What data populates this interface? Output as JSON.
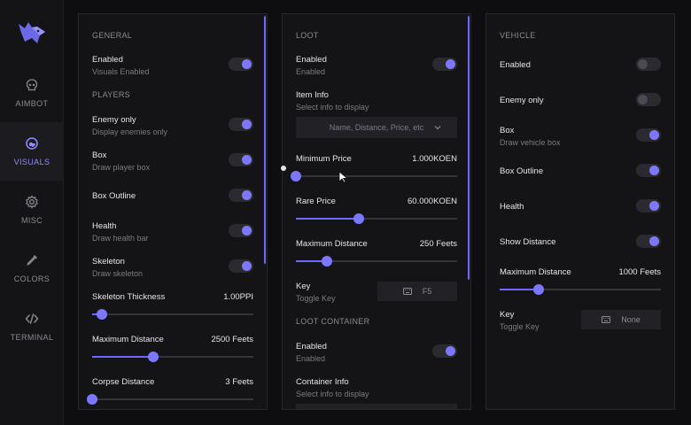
{
  "sidebar": {
    "logo_icon": "wolf-logo-icon",
    "items": [
      {
        "label": "AIMBOT",
        "icon": "skull-icon",
        "active": false
      },
      {
        "label": "VISUALS",
        "icon": "eye-icon",
        "active": true
      },
      {
        "label": "MISC",
        "icon": "gear-icon",
        "active": false
      },
      {
        "label": "COLORS",
        "icon": "eyedropper-icon",
        "active": false
      },
      {
        "label": "TERMINAL",
        "icon": "code-icon",
        "active": false
      }
    ]
  },
  "colors": {
    "accent": "#7b78ff",
    "background": "#0e0e10",
    "panel": "#141416"
  },
  "general": {
    "title": "GENERAL",
    "enabled": {
      "label": "Enabled",
      "desc": "Visuals Enabled",
      "on": true
    }
  },
  "players": {
    "title": "PLAYERS",
    "enemy_only": {
      "label": "Enemy only",
      "desc": "Display enemies only",
      "on": true
    },
    "box": {
      "label": "Box",
      "desc": "Draw player box",
      "on": true
    },
    "box_outline": {
      "label": "Box Outline",
      "on": true
    },
    "health": {
      "label": "Health",
      "desc": "Draw health bar",
      "on": true
    },
    "skeleton": {
      "label": "Skeleton",
      "desc": "Draw skeleton",
      "on": true
    },
    "skeleton_thickness": {
      "label": "Skeleton Thickness",
      "value": "1.00PPI",
      "fraction": 0.06
    },
    "max_distance": {
      "label": "Maximum Distance",
      "value": "2500 Feets",
      "fraction": 0.38
    },
    "corpse_distance": {
      "label": "Corpse Distance",
      "value": "3 Feets",
      "fraction": 0.0
    }
  },
  "loot": {
    "title": "LOOT",
    "enabled": {
      "label": "Enabled",
      "desc": "Enabled",
      "on": true
    },
    "item_info": {
      "label": "Item Info",
      "desc": "Select info to display",
      "dropdown": "Name, Distance, Price, etc"
    },
    "min_price": {
      "label": "Minimum Price",
      "value": "1.000KOEN",
      "fraction": 0.0
    },
    "rare_price": {
      "label": "Rare Price",
      "value": "60.000KOEN",
      "fraction": 0.39
    },
    "max_distance": {
      "label": "Maximum Distance",
      "value": "250 Feets",
      "fraction": 0.19
    },
    "key": {
      "label": "Key",
      "desc": "Toggle Key",
      "key": "F5"
    }
  },
  "loot_container": {
    "title": "LOOT CONTAINER",
    "enabled": {
      "label": "Enabled",
      "desc": "Enabled",
      "on": true
    },
    "container_info": {
      "label": "Container Info",
      "desc": "Select info to display"
    }
  },
  "vehicle": {
    "title": "VEHICLE",
    "enabled": {
      "label": "Enabled",
      "on": false
    },
    "enemy_only": {
      "label": "Enemy only",
      "on": false
    },
    "box": {
      "label": "Box",
      "desc": "Draw vehicle box",
      "on": true
    },
    "box_outline": {
      "label": "Box Outline",
      "on": true
    },
    "health": {
      "label": "Health",
      "on": true
    },
    "show_distance": {
      "label": "Show Distance",
      "on": true
    },
    "max_distance": {
      "label": "Maximum Distance",
      "value": "1000 Feets",
      "fraction": 0.24
    },
    "key": {
      "label": "Key",
      "desc": "Toggle Key",
      "key": "None"
    }
  }
}
